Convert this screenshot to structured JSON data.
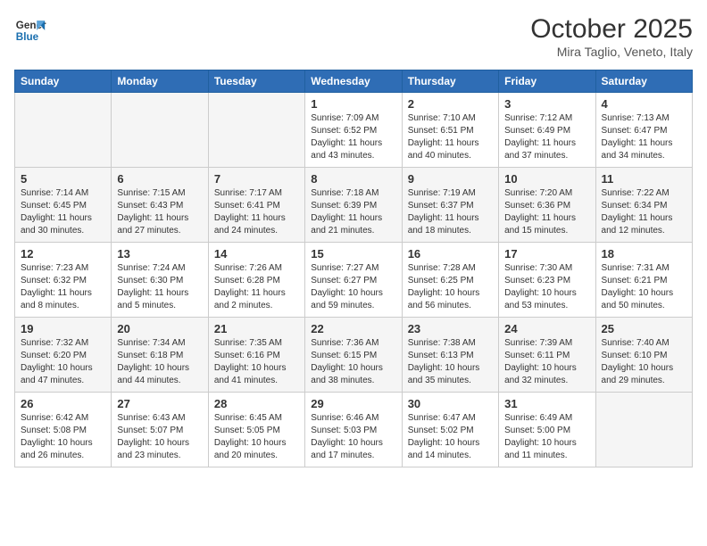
{
  "header": {
    "logo_line1": "General",
    "logo_line2": "Blue",
    "month": "October 2025",
    "location": "Mira Taglio, Veneto, Italy"
  },
  "days_of_week": [
    "Sunday",
    "Monday",
    "Tuesday",
    "Wednesday",
    "Thursday",
    "Friday",
    "Saturday"
  ],
  "weeks": [
    [
      {
        "num": "",
        "info": ""
      },
      {
        "num": "",
        "info": ""
      },
      {
        "num": "",
        "info": ""
      },
      {
        "num": "1",
        "info": "Sunrise: 7:09 AM\nSunset: 6:52 PM\nDaylight: 11 hours\nand 43 minutes."
      },
      {
        "num": "2",
        "info": "Sunrise: 7:10 AM\nSunset: 6:51 PM\nDaylight: 11 hours\nand 40 minutes."
      },
      {
        "num": "3",
        "info": "Sunrise: 7:12 AM\nSunset: 6:49 PM\nDaylight: 11 hours\nand 37 minutes."
      },
      {
        "num": "4",
        "info": "Sunrise: 7:13 AM\nSunset: 6:47 PM\nDaylight: 11 hours\nand 34 minutes."
      }
    ],
    [
      {
        "num": "5",
        "info": "Sunrise: 7:14 AM\nSunset: 6:45 PM\nDaylight: 11 hours\nand 30 minutes."
      },
      {
        "num": "6",
        "info": "Sunrise: 7:15 AM\nSunset: 6:43 PM\nDaylight: 11 hours\nand 27 minutes."
      },
      {
        "num": "7",
        "info": "Sunrise: 7:17 AM\nSunset: 6:41 PM\nDaylight: 11 hours\nand 24 minutes."
      },
      {
        "num": "8",
        "info": "Sunrise: 7:18 AM\nSunset: 6:39 PM\nDaylight: 11 hours\nand 21 minutes."
      },
      {
        "num": "9",
        "info": "Sunrise: 7:19 AM\nSunset: 6:37 PM\nDaylight: 11 hours\nand 18 minutes."
      },
      {
        "num": "10",
        "info": "Sunrise: 7:20 AM\nSunset: 6:36 PM\nDaylight: 11 hours\nand 15 minutes."
      },
      {
        "num": "11",
        "info": "Sunrise: 7:22 AM\nSunset: 6:34 PM\nDaylight: 11 hours\nand 12 minutes."
      }
    ],
    [
      {
        "num": "12",
        "info": "Sunrise: 7:23 AM\nSunset: 6:32 PM\nDaylight: 11 hours\nand 8 minutes."
      },
      {
        "num": "13",
        "info": "Sunrise: 7:24 AM\nSunset: 6:30 PM\nDaylight: 11 hours\nand 5 minutes."
      },
      {
        "num": "14",
        "info": "Sunrise: 7:26 AM\nSunset: 6:28 PM\nDaylight: 11 hours\nand 2 minutes."
      },
      {
        "num": "15",
        "info": "Sunrise: 7:27 AM\nSunset: 6:27 PM\nDaylight: 10 hours\nand 59 minutes."
      },
      {
        "num": "16",
        "info": "Sunrise: 7:28 AM\nSunset: 6:25 PM\nDaylight: 10 hours\nand 56 minutes."
      },
      {
        "num": "17",
        "info": "Sunrise: 7:30 AM\nSunset: 6:23 PM\nDaylight: 10 hours\nand 53 minutes."
      },
      {
        "num": "18",
        "info": "Sunrise: 7:31 AM\nSunset: 6:21 PM\nDaylight: 10 hours\nand 50 minutes."
      }
    ],
    [
      {
        "num": "19",
        "info": "Sunrise: 7:32 AM\nSunset: 6:20 PM\nDaylight: 10 hours\nand 47 minutes."
      },
      {
        "num": "20",
        "info": "Sunrise: 7:34 AM\nSunset: 6:18 PM\nDaylight: 10 hours\nand 44 minutes."
      },
      {
        "num": "21",
        "info": "Sunrise: 7:35 AM\nSunset: 6:16 PM\nDaylight: 10 hours\nand 41 minutes."
      },
      {
        "num": "22",
        "info": "Sunrise: 7:36 AM\nSunset: 6:15 PM\nDaylight: 10 hours\nand 38 minutes."
      },
      {
        "num": "23",
        "info": "Sunrise: 7:38 AM\nSunset: 6:13 PM\nDaylight: 10 hours\nand 35 minutes."
      },
      {
        "num": "24",
        "info": "Sunrise: 7:39 AM\nSunset: 6:11 PM\nDaylight: 10 hours\nand 32 minutes."
      },
      {
        "num": "25",
        "info": "Sunrise: 7:40 AM\nSunset: 6:10 PM\nDaylight: 10 hours\nand 29 minutes."
      }
    ],
    [
      {
        "num": "26",
        "info": "Sunrise: 6:42 AM\nSunset: 5:08 PM\nDaylight: 10 hours\nand 26 minutes."
      },
      {
        "num": "27",
        "info": "Sunrise: 6:43 AM\nSunset: 5:07 PM\nDaylight: 10 hours\nand 23 minutes."
      },
      {
        "num": "28",
        "info": "Sunrise: 6:45 AM\nSunset: 5:05 PM\nDaylight: 10 hours\nand 20 minutes."
      },
      {
        "num": "29",
        "info": "Sunrise: 6:46 AM\nSunset: 5:03 PM\nDaylight: 10 hours\nand 17 minutes."
      },
      {
        "num": "30",
        "info": "Sunrise: 6:47 AM\nSunset: 5:02 PM\nDaylight: 10 hours\nand 14 minutes."
      },
      {
        "num": "31",
        "info": "Sunrise: 6:49 AM\nSunset: 5:00 PM\nDaylight: 10 hours\nand 11 minutes."
      },
      {
        "num": "",
        "info": ""
      }
    ]
  ]
}
